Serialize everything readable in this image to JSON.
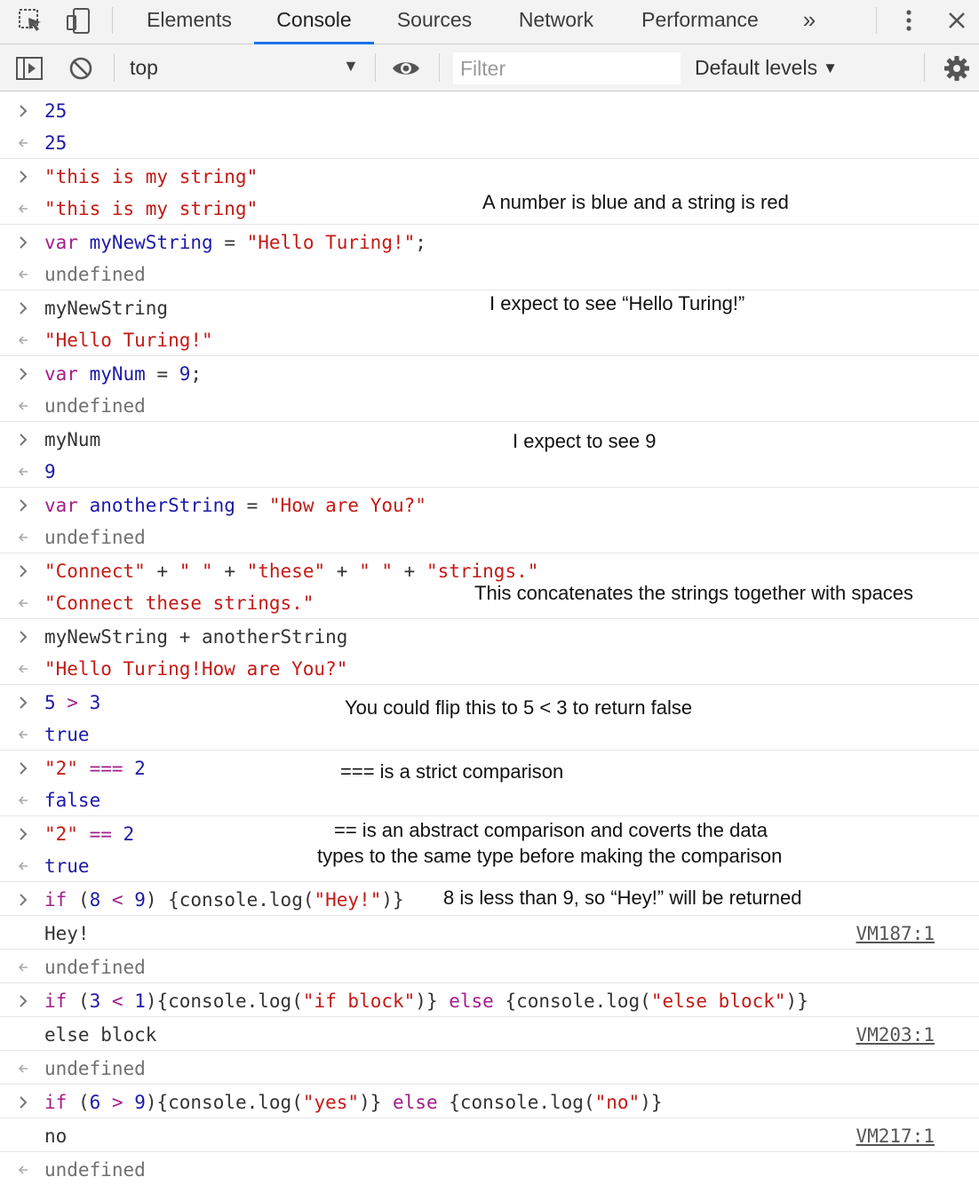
{
  "tabs": {
    "elements": "Elements",
    "console": "Console",
    "sources": "Sources",
    "network": "Network",
    "performance": "Performance",
    "more": "»"
  },
  "toolbar": {
    "context": "top",
    "filter_placeholder": "Filter",
    "levels": "Default levels"
  },
  "console": {
    "r1": "25",
    "r2": "25",
    "r3": "\"this is my string\"",
    "r4": "\"this is my string\"",
    "r5": {
      "kw": "var",
      "id": "myNewString",
      "op": " = ",
      "str": "\"Hello Turing!\"",
      "end": ";"
    },
    "r6": "undefined",
    "r7": "myNewString",
    "r8": "\"Hello Turing!\"",
    "r9": {
      "kw": "var",
      "id": "myNum",
      "op": " = ",
      "num": "9",
      "end": ";"
    },
    "r10": "undefined",
    "r11": "myNum",
    "r12": "9",
    "r13": {
      "kw": "var",
      "id": "anotherString",
      "op": " = ",
      "str": "\"How are You?\""
    },
    "r14": "undefined",
    "r15": {
      "s1": "\"Connect\"",
      "plus": " + ",
      "s2": "\" \"",
      "s3": "\"these\"",
      "s4": "\" \"",
      "s5": "\"strings.\""
    },
    "r16": "\"Connect these strings.\"",
    "r17": {
      "a": "myNewString",
      "plus": " + ",
      "b": "anotherString"
    },
    "r18": "\"Hello Turing!How are You?\"",
    "r19": {
      "a": "5",
      "op": " > ",
      "b": "3"
    },
    "r20": "true",
    "r21": {
      "a": "\"2\"",
      "op": " === ",
      "b": "2"
    },
    "r22": "false",
    "r23": {
      "a": "\"2\"",
      "op": " == ",
      "b": "2"
    },
    "r24": "true",
    "r25": {
      "kw": "if",
      "p1": " (",
      "a": "8",
      "op": " < ",
      "b": "9",
      "p2": ") {console.log(",
      "s": "\"Hey!\"",
      "p3": ")}"
    },
    "r26": {
      "text": "Hey!",
      "src": "VM187:1"
    },
    "r27": "undefined",
    "r28": {
      "kw": "if",
      "p1": " (",
      "a": "3",
      "op": " < ",
      "b": "1",
      "p2": "){console.log(",
      "s1": "\"if block\"",
      "p3": ")} ",
      "kw2": "else",
      "p4": " {console.log(",
      "s2": "\"else block\"",
      "p5": ")}"
    },
    "r29": {
      "text": "else block",
      "src": "VM203:1"
    },
    "r30": "undefined",
    "r31": {
      "kw": "if",
      "p1": " (",
      "a": "6",
      "op": " > ",
      "b": "9",
      "p2": "){console.log(",
      "s1": "\"yes\"",
      "p3": ")} ",
      "kw2": "else",
      "p4": " {console.log(",
      "s2": "\"no\"",
      "p5": ")}"
    },
    "r32": {
      "text": "no",
      "src": "VM217:1"
    },
    "r33": "undefined"
  },
  "annotations": {
    "a1": "A number is blue and a string is red",
    "a2": "I expect to see “Hello Turing!”",
    "a3": "I expect to see 9",
    "a4": "This concatenates the strings together with spaces",
    "a5": "You could flip this to 5 < 3 to return false",
    "a6": "=== is a strict comparison",
    "a7_line1": "== is an abstract comparison and coverts the data",
    "a7_line2": "types to the same type before making the comparison",
    "a8": "8 is less than 9, so “Hey!” will be returned"
  },
  "colors": {
    "keyword": "#a51d8c",
    "identifier": "#1d1aa8",
    "string": "#c41a16",
    "accent": "#1a73e8"
  }
}
